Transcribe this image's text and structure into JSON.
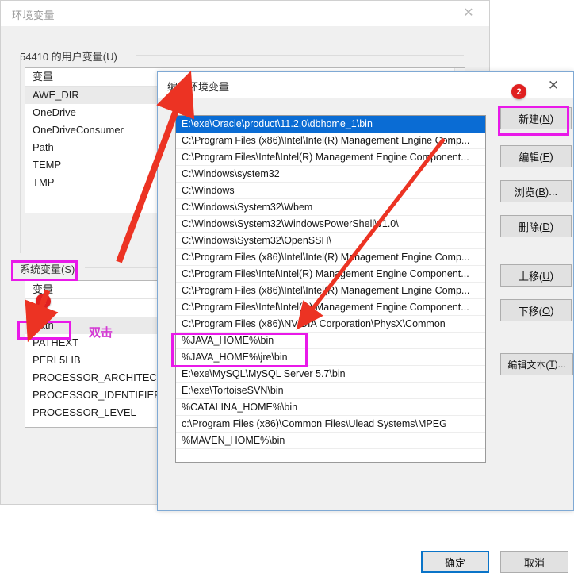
{
  "background_window": {
    "title": "环境变量",
    "close_icon": "close-icon",
    "user_vars": {
      "label": "54410 的用户变量(U)",
      "column_header": "变量",
      "rows": [
        "AWE_DIR",
        "OneDrive",
        "OneDriveConsumer",
        "Path",
        "TEMP",
        "TMP"
      ],
      "selected_index": 0
    },
    "system_vars": {
      "label": "系统变量(S)",
      "column_header": "变量",
      "rows": [
        "OS",
        "Path",
        "PATHEXT",
        "PERL5LIB",
        "PROCESSOR_ARCHITECT...",
        "PROCESSOR_IDENTIFIER",
        "PROCESSOR_LEVEL"
      ],
      "selected_row": "Path"
    }
  },
  "edit_dialog": {
    "title": "编辑环境变量",
    "close_icon": "close-icon",
    "path_entries": [
      "E:\\exe\\Oracle\\product\\11.2.0\\dbhome_1\\bin",
      "C:\\Program Files (x86)\\Intel\\Intel(R) Management Engine Comp...",
      "C:\\Program Files\\Intel\\Intel(R) Management Engine Component...",
      "C:\\Windows\\system32",
      "C:\\Windows",
      "C:\\Windows\\System32\\Wbem",
      "C:\\Windows\\System32\\WindowsPowerShell\\v1.0\\",
      "C:\\Windows\\System32\\OpenSSH\\",
      "C:\\Program Files (x86)\\Intel\\Intel(R) Management Engine Comp...",
      "C:\\Program Files\\Intel\\Intel(R) Management Engine Component...",
      "C:\\Program Files (x86)\\Intel\\Intel(R) Management Engine Comp...",
      "C:\\Program Files\\Intel\\Intel(R) Management Engine Component...",
      "C:\\Program Files (x86)\\NVIDIA Corporation\\PhysX\\Common",
      "%JAVA_HOME%\\bin",
      "%JAVA_HOME%\\jre\\bin",
      "E:\\exe\\MySQL\\MySQL Server 5.7\\bin",
      "E:\\exe\\TortoiseSVN\\bin",
      "%CATALINA_HOME%\\bin",
      "c:\\Program Files (x86)\\Common Files\\Ulead Systems\\MPEG",
      "%MAVEN_HOME%\\bin"
    ],
    "selected_index": 0,
    "side_buttons": [
      {
        "label": "新建(N)",
        "name": "new-button"
      },
      {
        "label": "编辑(E)",
        "name": "edit-button"
      },
      {
        "label": "浏览(B)...",
        "name": "browse-button"
      },
      {
        "label": "删除(D)",
        "name": "delete-button"
      },
      {
        "label": "上移(U)",
        "name": "move-up-button"
      },
      {
        "label": "下移(O)",
        "name": "move-down-button"
      },
      {
        "label": "编辑文本(T)...",
        "name": "edit-text-button"
      }
    ],
    "ok_label": "确定",
    "cancel_label": "取消"
  },
  "annotations": {
    "badge1": "1",
    "badge2": "2",
    "double_click_text": "双击",
    "highlight_color": "#e919e9",
    "badge_color": "#e02020",
    "arrow_color": "#ec3323"
  }
}
